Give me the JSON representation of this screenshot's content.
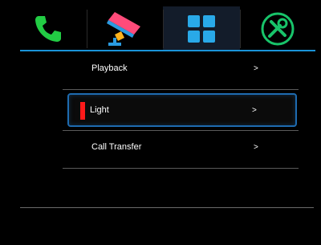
{
  "tabs": [
    {
      "name": "call",
      "icon": "phone-icon",
      "active": false,
      "color": "#22cc44"
    },
    {
      "name": "monitor",
      "icon": "camera-icon",
      "active": false,
      "color": "#ff4b7a"
    },
    {
      "name": "apps",
      "icon": "grid-icon",
      "active": true,
      "color": "#29a9e8"
    },
    {
      "name": "settings",
      "icon": "tools-icon",
      "active": false,
      "color": "#18c46a"
    }
  ],
  "menu": {
    "items": [
      {
        "label": "Playback",
        "arrow": ">"
      },
      {
        "label": "Light",
        "arrow": ">",
        "selected": true
      },
      {
        "label": "Call Transfer",
        "arrow": ">"
      }
    ]
  },
  "colors": {
    "accent": "#1a93d8",
    "selection_marker": "#ff1a1a"
  }
}
